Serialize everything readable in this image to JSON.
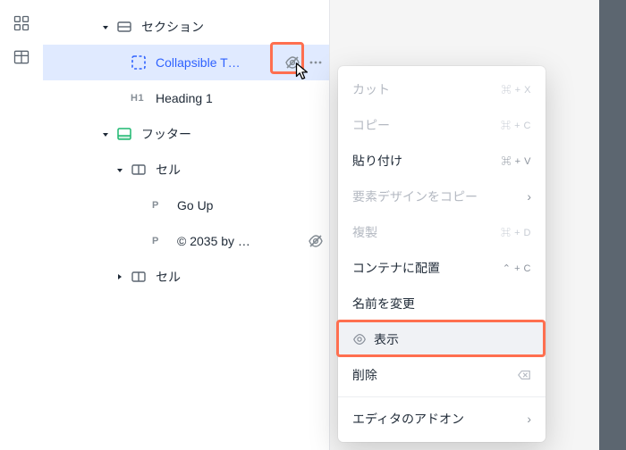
{
  "rail": {
    "items": [
      {
        "name": "layout-grid-icon"
      },
      {
        "name": "table-icon"
      }
    ]
  },
  "tree": {
    "rows": [
      {
        "indent": 64,
        "arrow": "down",
        "iconKind": "section-dark",
        "label": "セクション"
      },
      {
        "indent": 80,
        "arrow": "",
        "iconKind": "container-blue",
        "label": "Collapsible T…",
        "selected": true,
        "trailing": [
          "eye-off",
          "more"
        ]
      },
      {
        "indent": 80,
        "arrow": "",
        "typeText": "H1",
        "label": "Heading 1"
      },
      {
        "indent": 64,
        "arrow": "down",
        "iconKind": "footer-green",
        "label": "フッター"
      },
      {
        "indent": 80,
        "arrow": "down",
        "iconKind": "cell-dark",
        "label": "セル"
      },
      {
        "indent": 104,
        "arrow": "",
        "typeText": "P",
        "label": "Go Up"
      },
      {
        "indent": 104,
        "arrow": "",
        "typeText": "P",
        "label": "© 2035 by …",
        "trailing": [
          "eye-off-plain"
        ]
      },
      {
        "indent": 80,
        "arrow": "right",
        "iconKind": "cell-dark",
        "label": "セル"
      }
    ]
  },
  "contextMenu": {
    "items": [
      {
        "label": "カット",
        "shortcut": "⌘ + X",
        "disabled": true
      },
      {
        "label": "コピー",
        "shortcut": "⌘ + C",
        "disabled": true
      },
      {
        "label": "貼り付け",
        "shortcut": "⌘ + V"
      },
      {
        "label": "要素デザインをコピー",
        "chevron": true,
        "disabled": true
      },
      {
        "label": "複製",
        "shortcut": "⌘ + D",
        "disabled": true
      },
      {
        "label": "コンテナに配置",
        "shortcut": "⌃ + C"
      },
      {
        "label": "名前を変更"
      },
      {
        "label": "表示",
        "preIcon": "eye",
        "hover": true,
        "highlight": true
      },
      {
        "label": "削除",
        "endIcon": "backspace"
      },
      {
        "label": "エディタのアドオン",
        "chevron": true
      }
    ],
    "separatorsBefore": [
      9
    ]
  }
}
